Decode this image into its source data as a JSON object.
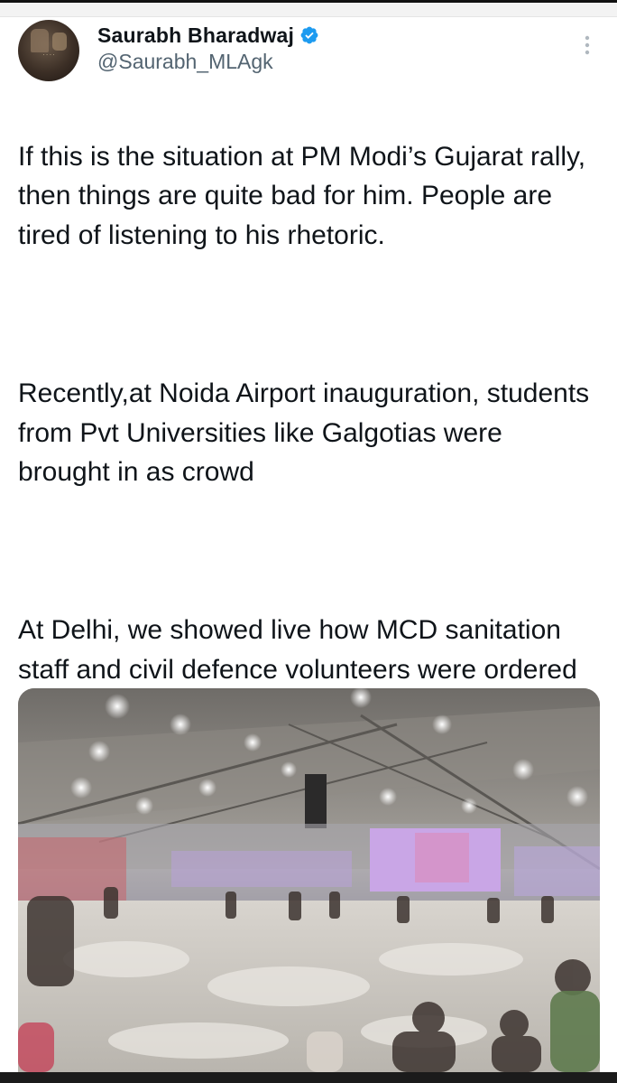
{
  "tweet": {
    "author": {
      "name": "Saurabh Bharadwaj",
      "handle": "@Saurabh_MLAgk",
      "verified": true,
      "avatar_icon": "profile-avatar",
      "verified_color": "#1d9bf0"
    },
    "paragraphs": [
      "If this is the situation at PM Modi’s Gujarat rally, then things are quite bad for him. People are tired of listening to his rhetoric.",
      "Recently,at Noida Airport inauguration, students from Pvt Universities like Galgotias were brought in as crowd",
      "At Delhi, we showed live how MCD sanitation staff and civil defence volunteers were ordered by DM/DC to report on Sunday. Then they were put into busses to be taken to Modi’s rally."
    ],
    "media": {
      "type": "video-thumbnail"
    },
    "more_icon": "more-vertical-icon"
  }
}
